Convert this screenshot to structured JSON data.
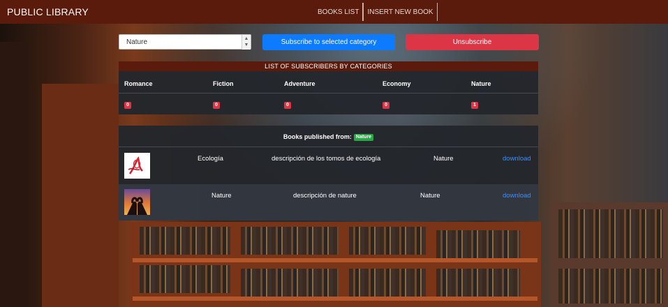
{
  "navbar": {
    "brand": "PUBLIC LIBRARY",
    "links": [
      "BOOKS LIST",
      "INSERT NEW BOOK"
    ]
  },
  "controls": {
    "category_selected": "Nature",
    "subscribe_label": "Subscribe to selected category",
    "unsubscribe_label": "Unsubscribe"
  },
  "subscribers": {
    "title": "LIST OF SUBSCRIBERS BY CATEGORIES",
    "columns": [
      "Romance",
      "Fiction",
      "Adventure",
      "Economy",
      "Nature"
    ],
    "counts": [
      "0",
      "0",
      "0",
      "0",
      "1"
    ]
  },
  "books": {
    "title_prefix": "Books published from:",
    "category_badge": "Nature",
    "rows": [
      {
        "title": "Ecología",
        "description": "descripción de los tomos de ecología",
        "category": "Nature",
        "action": "download"
      },
      {
        "title": "Nature",
        "description": "descripción de nature",
        "category": "Nature",
        "action": "download"
      }
    ]
  },
  "colors": {
    "navbar": "#5a1a0c",
    "primary": "#0d7bff",
    "danger": "#dc3545",
    "success": "#28a745",
    "link": "#3a8fff"
  }
}
